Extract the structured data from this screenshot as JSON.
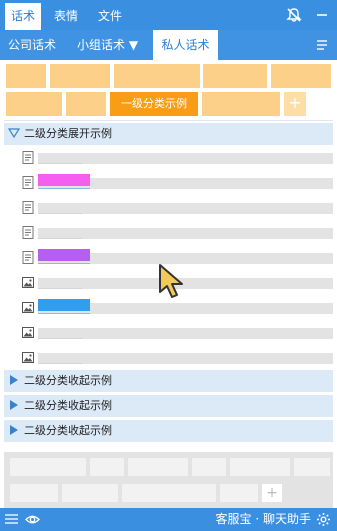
{
  "top_tabs": [
    {
      "label": "话术",
      "active": true
    },
    {
      "label": "表情",
      "active": false
    },
    {
      "label": "文件",
      "active": false
    }
  ],
  "sub_tabs": [
    {
      "label": "公司话术"
    },
    {
      "label": "小组话术 ▼"
    },
    {
      "label": "私人话术",
      "active": true
    }
  ],
  "category_grid": {
    "selected_label": "一级分类示例",
    "add_label": "+"
  },
  "groups": {
    "expanded_label": "二级分类展开示例",
    "collapsed": [
      {
        "label": "二级分类收起示例"
      },
      {
        "label": "二级分类收起示例"
      },
      {
        "label": "二级分类收起示例"
      }
    ]
  },
  "rows": [
    {
      "icon": "document-icon",
      "tag": null
    },
    {
      "icon": "document-icon",
      "tag": "#f45ef1"
    },
    {
      "icon": "document-icon",
      "tag": null
    },
    {
      "icon": "document-icon",
      "tag": null
    },
    {
      "icon": "document-icon",
      "tag": "#b65ef0"
    },
    {
      "icon": "image-icon",
      "tag": null
    },
    {
      "icon": "image-icon",
      "tag": "#2f9df0"
    },
    {
      "icon": "image-icon",
      "tag": null
    },
    {
      "icon": "image-icon",
      "tag": null
    }
  ],
  "tray": {
    "plus_label": "+"
  },
  "footer": {
    "brand": "客服宝 · 聊天助手"
  },
  "colors": {
    "accent": "#3b8fe0",
    "chip": "#fdd08a",
    "chip_selected": "#f99d16"
  }
}
